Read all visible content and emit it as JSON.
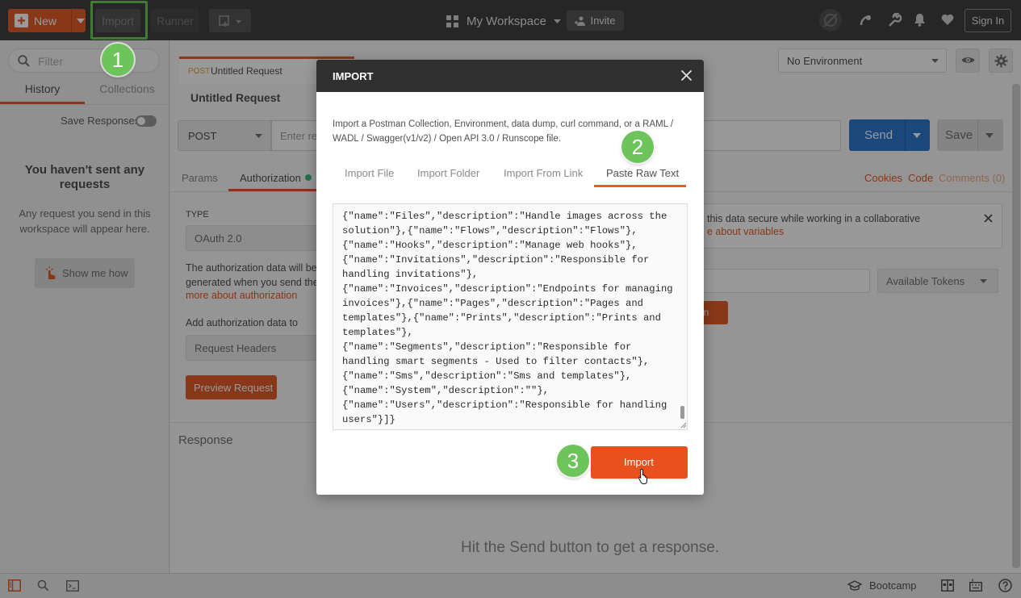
{
  "header": {
    "new_label": "New",
    "import_label": "Import",
    "runner_label": "Runner",
    "workspace_label": "My Workspace",
    "invite_label": "Invite",
    "signin_label": "Sign In"
  },
  "steps": [
    "1",
    "2",
    "3"
  ],
  "sidebar": {
    "filter_placeholder": "Filter",
    "tabs": [
      "History",
      "Collections"
    ],
    "save_responses_label": "Save Responses",
    "empty_title": "You haven't sent any requests",
    "empty_desc": "Any request you send in this workspace will appear here.",
    "show_me_label": "Show me how"
  },
  "request": {
    "tab_method": "POST",
    "tab_name": "Untitled Request",
    "title": "Untitled Request",
    "method": "POST",
    "url_placeholder": "Enter re",
    "send_label": "Send",
    "save_label": "Save",
    "environment": "No Environment",
    "tabs": [
      "Params",
      "Authorization"
    ],
    "links": [
      "Cookies",
      "Code",
      "Comments (0)"
    ]
  },
  "auth": {
    "type_label": "TYPE",
    "type_value": "OAuth 2.0",
    "desc_line1": "The authorization data will be",
    "desc_line2": "generated when you send the",
    "desc_link": "more about authorization",
    "add_to_label": "Add authorization data to",
    "add_to_value": "Request Headers",
    "preview_label": "Preview Request",
    "info_text": "this data secure while working in a collaborative",
    "info_link": "e about variables",
    "available_tokens": "Available Tokens",
    "get_token_fragment": "ken"
  },
  "response": {
    "label": "Response",
    "hint": "Hit the Send button to get a response."
  },
  "footer": {
    "bootcamp_label": "Bootcamp"
  },
  "modal": {
    "title": "IMPORT",
    "description": "Import a Postman Collection, Environment, data dump, curl command, or a RAML / WADL / Swagger(v1/v2) / Open API 3.0 / Runscope file.",
    "tabs": [
      "Import File",
      "Import Folder",
      "Import From Link",
      "Paste Raw Text"
    ],
    "raw_text": "{\"name\":\"Files\",\"description\":\"Handle images across the\nsolution\"},{\"name\":\"Flows\",\"description\":\"Flows\"},\n{\"name\":\"Hooks\",\"description\":\"Manage web hooks\"},\n{\"name\":\"Invitations\",\"description\":\"Responsible for\nhandling invitations\"},\n{\"name\":\"Invoices\",\"description\":\"Endpoints for managing\ninvoices\"},{\"name\":\"Pages\",\"description\":\"Pages and\ntemplates\"},{\"name\":\"Prints\",\"description\":\"Prints and\ntemplates\"},\n{\"name\":\"Segments\",\"description\":\"Responsible for\nhandling smart segments - Used to filter contacts\"},\n{\"name\":\"Sms\",\"description\":\"Sms and templates\"},\n{\"name\":\"System\",\"description\":\"\"},\n{\"name\":\"Users\",\"description\":\"Responsible for handling\nusers\"}]}",
    "import_button": "Import"
  },
  "colors": {
    "accent": "#e35c2a",
    "send_blue": "#2c79d0",
    "header_bg": "#404040",
    "step_green": "#6cc45b"
  }
}
